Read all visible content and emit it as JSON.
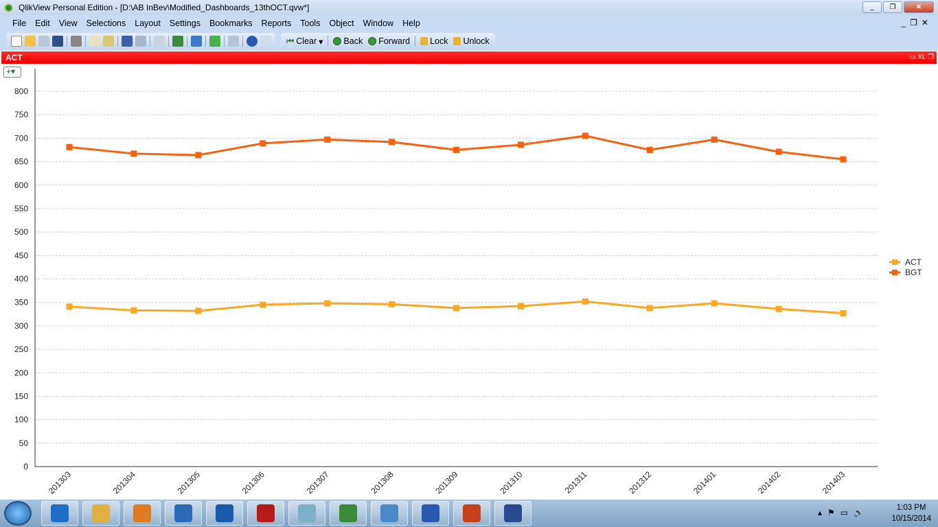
{
  "window": {
    "title": "QlikView Personal Edition - [D:\\AB InBev\\Modified_Dashboards_13thOCT.qvw*]",
    "min": "_",
    "restore": "❐",
    "close": "✕"
  },
  "menu": [
    "File",
    "Edit",
    "View",
    "Selections",
    "Layout",
    "Settings",
    "Bookmarks",
    "Reports",
    "Tools",
    "Object",
    "Window",
    "Help"
  ],
  "toolbar": {
    "clear": "Clear",
    "back": "Back",
    "forward": "Forward",
    "lock": "Lock",
    "unlock": "Unlock"
  },
  "object": {
    "caption": "ACT",
    "caption_icons": "XL"
  },
  "chart_data": {
    "type": "line",
    "title": "ACT",
    "categories": [
      "201303",
      "201304",
      "201305",
      "201306",
      "201307",
      "201308",
      "201309",
      "201310",
      "201311",
      "201312",
      "201401",
      "201402",
      "201403"
    ],
    "series": [
      {
        "name": "ACT",
        "color": "#f9a825",
        "values": [
          341,
          333,
          332,
          345,
          348,
          346,
          338,
          342,
          352,
          338,
          348,
          336,
          327
        ]
      },
      {
        "name": "BGT",
        "color": "#f4620f",
        "values": [
          681,
          667,
          664,
          689,
          697,
          692,
          675,
          686,
          705,
          675,
          697,
          671,
          655
        ]
      }
    ],
    "yticks": [
      0,
      50,
      100,
      150,
      200,
      250,
      300,
      350,
      400,
      450,
      500,
      550,
      600,
      650,
      700,
      750,
      800
    ],
    "ylim": [
      0,
      800
    ],
    "grid": true,
    "legend": "right"
  },
  "taskbar": {
    "apps": [
      "IE",
      "Files",
      "Media",
      "Lync",
      "Outlook",
      "Acrobat",
      "Notes",
      "QlikView",
      "Photos",
      "Word",
      "PowerPoint",
      "RDP"
    ],
    "time": "1:03 PM",
    "date": "10/15/2014"
  }
}
